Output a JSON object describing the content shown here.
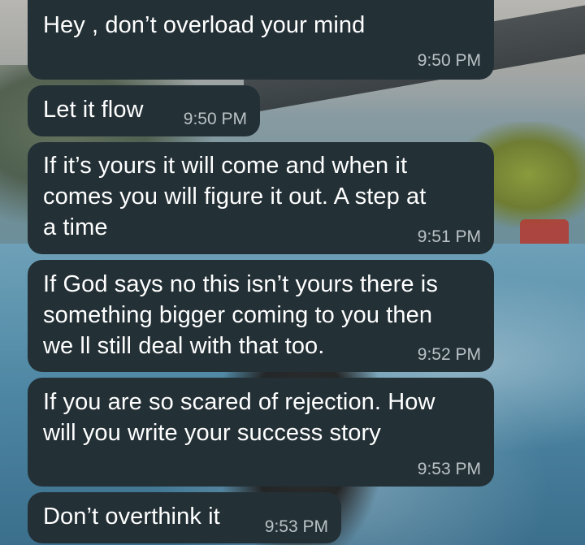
{
  "messages": [
    {
      "text": "Hey , don’t overload your mind",
      "time": "9:50 PM"
    },
    {
      "text": "Let it flow",
      "time": "9:50 PM"
    },
    {
      "text": "If it’s yours it will come and when it\ncomes you will figure it out. A step at\na time",
      "time": "9:51 PM"
    },
    {
      "text": "If God says no this isn’t yours there is\nsomething bigger coming to you then\nwe ll still deal with that too.",
      "time": "9:52 PM"
    },
    {
      "text": "If you are so scared of rejection. How\nwill you write your success story",
      "time": "9:53 PM"
    },
    {
      "text": "Don’t overthink it",
      "time": "9:53 PM"
    }
  ],
  "colors": {
    "bubble_background": "#233036",
    "message_text": "#ffffff",
    "timestamp_text": "#b9c2c6"
  }
}
